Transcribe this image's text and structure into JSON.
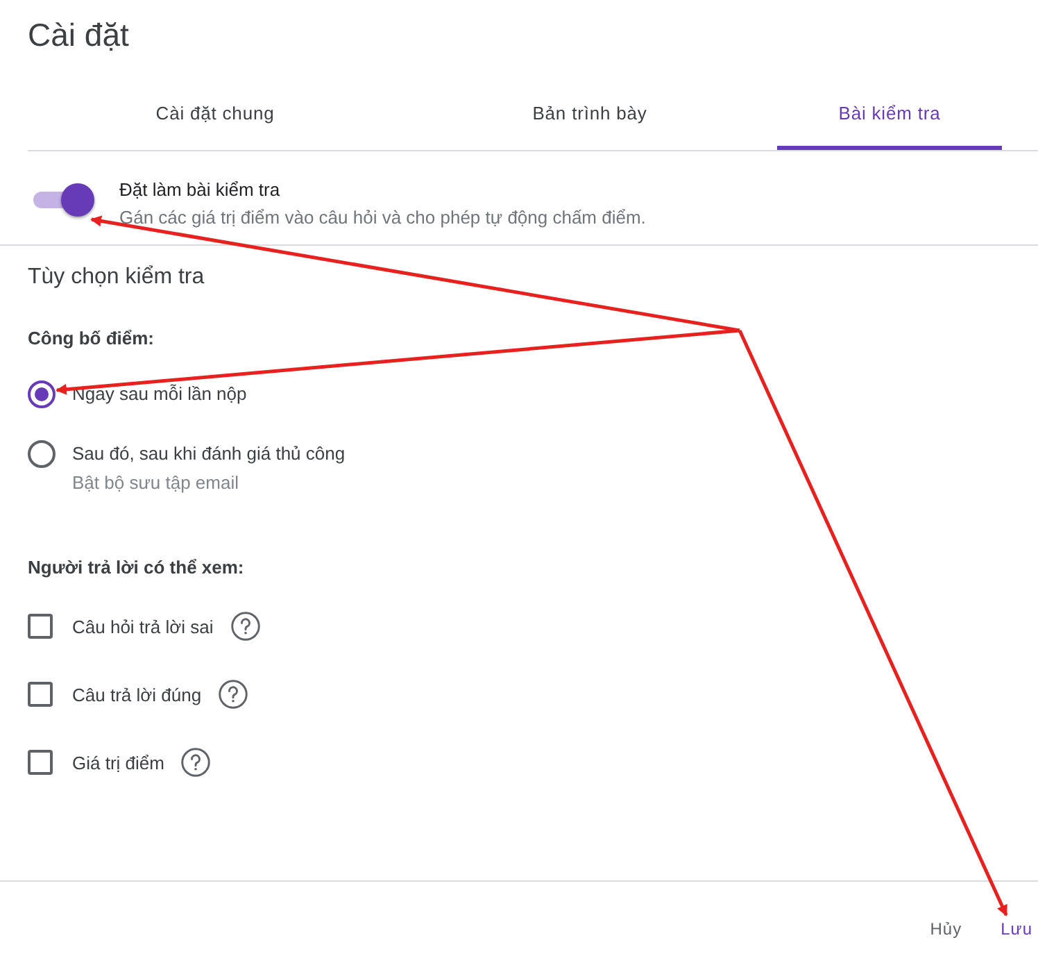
{
  "title": "Cài đặt",
  "tabs": [
    {
      "label": "Cài đặt chung",
      "selected": false
    },
    {
      "label": "Bản trình bày",
      "selected": false
    },
    {
      "label": "Bài kiểm tra",
      "selected": true
    }
  ],
  "quiz_toggle": {
    "label": "Đặt làm bài kiểm tra",
    "description": "Gán các giá trị điểm vào câu hỏi và cho phép tự động chấm điểm.",
    "on": true
  },
  "section_title": "Tùy chọn kiểm tra",
  "release_grade": {
    "label": "Công bố điểm:",
    "options": [
      {
        "label": "Ngay sau mỗi lần nộp",
        "selected": true
      },
      {
        "label": "Sau đó, sau khi đánh giá thủ công",
        "sublabel": "Bật bộ sưu tập email",
        "selected": false
      }
    ]
  },
  "respondent_view": {
    "label": "Người trả lời có thể xem:",
    "options": [
      {
        "label": "Câu hỏi trả lời sai",
        "checked": false
      },
      {
        "label": "Câu trả lời đúng",
        "checked": false
      },
      {
        "label": "Giá trị điểm",
        "checked": false
      }
    ]
  },
  "buttons": [
    {
      "label": "Hủy",
      "kind": "cancel"
    },
    {
      "label": "Lưu",
      "kind": "save"
    }
  ]
}
